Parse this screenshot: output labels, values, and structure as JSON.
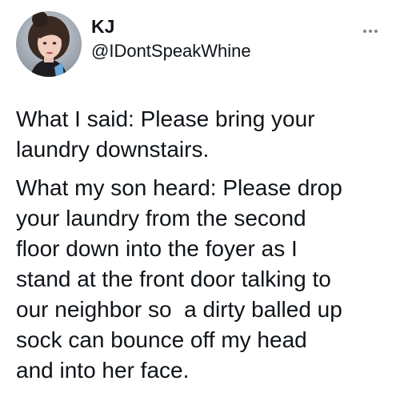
{
  "tweet": {
    "author": {
      "display_name": "KJ",
      "handle": "@IDontSpeakWhine"
    },
    "more_icon": "ellipsis-icon",
    "body": {
      "paragraph_1": "What I said: Please bring your\nlaundry downstairs.",
      "paragraph_2": "What my son heard: Please drop\nyour laundry from the second\nfloor down into the foyer as I\nstand at the front door talking to\nour neighbor so  a dirty balled up\nsock can bounce off my head\nand into her face."
    }
  }
}
